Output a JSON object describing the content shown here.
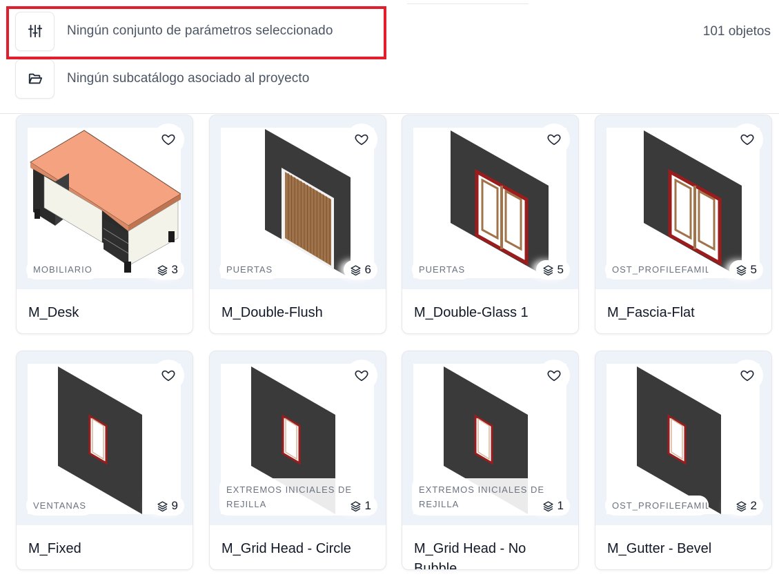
{
  "filters": {
    "parameter_set": {
      "icon": "sliders-icon",
      "label": "Ningún conjunto de parámetros seleccionado"
    },
    "subcatalog": {
      "icon": "folder-open-icon",
      "label": "Ningún subcatálogo asociado al proyecto"
    }
  },
  "object_count": "101 objetos",
  "colors": {
    "highlight": "#e11d2e",
    "wall": "#3a3a3a",
    "frame": "#9b1c1c",
    "wood": "#a0734a",
    "desk_top": "#f4a27f"
  },
  "cards": [
    {
      "name": "M_Desk",
      "category": "MOBILIARIO",
      "layers": "3",
      "preview": "desk"
    },
    {
      "name": "M_Double-Flush",
      "category": "PUERTAS",
      "layers": "6",
      "preview": "door-flush"
    },
    {
      "name": "M_Double-Glass 1",
      "category": "PUERTAS",
      "layers": "5",
      "preview": "door-glass"
    },
    {
      "name": "M_Fascia-Flat",
      "category": "OST_PROFILEFAMILIES",
      "layers": "5",
      "preview": "door-glass"
    },
    {
      "name": "M_Fixed",
      "category": "VENTANAS",
      "layers": "9",
      "preview": "window"
    },
    {
      "name": "M_Grid Head - Circle",
      "category": "EXTREMOS INICIALES DE REJILLA",
      "layers": "1",
      "preview": "window"
    },
    {
      "name": "M_Grid Head - No Bubble",
      "category": "EXTREMOS INICIALES DE REJILLA",
      "layers": "1",
      "preview": "window"
    },
    {
      "name": "M_Gutter - Bevel",
      "category": "OST_PROFILEFAMILIES",
      "layers": "2",
      "preview": "window"
    }
  ]
}
